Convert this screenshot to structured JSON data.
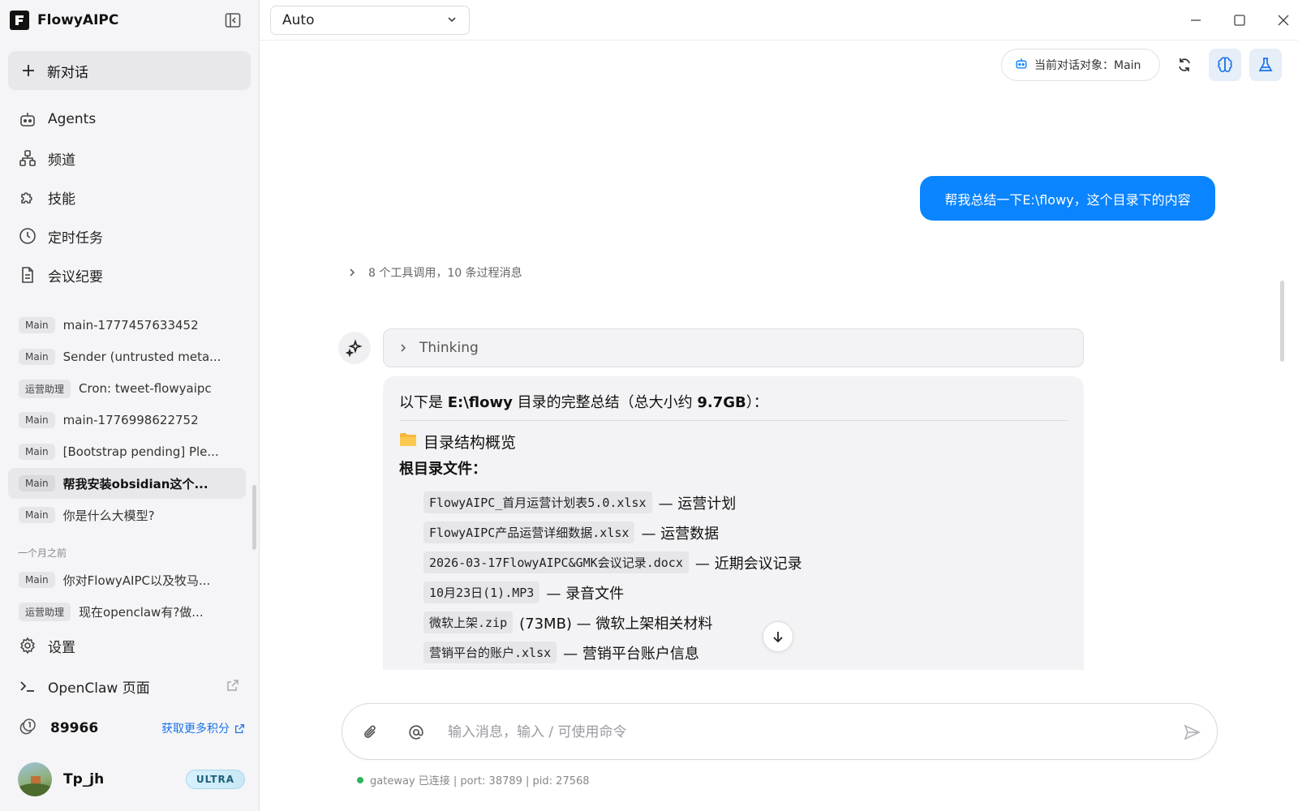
{
  "app": {
    "name": "FlowyAIPC"
  },
  "sidebar": {
    "new_chat": "新对话",
    "nav": [
      {
        "label": "Agents",
        "icon": "robot-icon"
      },
      {
        "label": "频道",
        "icon": "network-icon"
      },
      {
        "label": "技能",
        "icon": "puzzle-icon"
      },
      {
        "label": "定时任务",
        "icon": "clock-icon"
      },
      {
        "label": "会议纪要",
        "icon": "document-icon"
      }
    ],
    "conversations": [
      {
        "badge": "Main",
        "title": "main-1777457633452"
      },
      {
        "badge": "Main",
        "title": "Sender (untrusted meta..."
      },
      {
        "badge": "运营助理",
        "title": "Cron: tweet-flowyaipc"
      },
      {
        "badge": "Main",
        "title": "main-1776998622752"
      },
      {
        "badge": "Main",
        "title": "[Bootstrap pending] Ple..."
      },
      {
        "badge": "Main",
        "title": "帮我安装obsidian这个...",
        "active": true
      },
      {
        "badge": "Main",
        "title": "你是什么大模型?"
      }
    ],
    "section_older": "一个月之前",
    "older_conversations": [
      {
        "badge": "Main",
        "title": "你对FlowyAIPC以及牧马..."
      },
      {
        "badge": "运营助理",
        "title": "现在openclaw有?做..."
      }
    ],
    "settings": "设置",
    "openclaw": "OpenClaw 页面",
    "points": {
      "value": "89966",
      "link": "获取更多积分"
    },
    "user": {
      "name": "Tp_jh",
      "plan": "ULTRA"
    }
  },
  "topbar": {
    "model": "Auto"
  },
  "main": {
    "agent_pill": "当前对话对象：Main",
    "user_message": "帮我总结一下E:\\flowy，这个目录下的内容",
    "tool_summary": "8 个工具调用，10 条过程消息",
    "thinking_label": "Thinking",
    "answer": {
      "intro_prefix": "以下是 ",
      "intro_path": "E:\\flowy",
      "intro_mid": " 目录的完整总结（总大小约 ",
      "intro_size": "9.7GB",
      "intro_suffix": "）：",
      "section_title": "目录结构概览",
      "subsection_title": "根目录文件：",
      "files": [
        {
          "name": "FlowyAIPC_首月运营计划表5.0.xlsx",
          "desc": "— 运营计划"
        },
        {
          "name": "FlowyAIPC产品运营详细数据.xlsx",
          "desc": "— 运营数据"
        },
        {
          "name": "2026-03-17FlowyAIPC&GMK会议记录.docx",
          "desc": "— 近期会议记录"
        },
        {
          "name": "10月23日(1).MP3",
          "desc": "— 录音文件"
        },
        {
          "name": "微软上架.zip",
          "desc": "(73MB) — 微软上架相关材料"
        },
        {
          "name": "营销平台的账户.xlsx",
          "desc": "— 营销平台账户信息"
        }
      ]
    }
  },
  "composer": {
    "placeholder": "输入消息，输入 / 可使用命令"
  },
  "status": {
    "text": "gateway 已连接 | port: 38789 | pid: 27568"
  },
  "colors": {
    "accent": "#0a84ff",
    "link": "#1a73e8",
    "connected": "#2db55d"
  }
}
